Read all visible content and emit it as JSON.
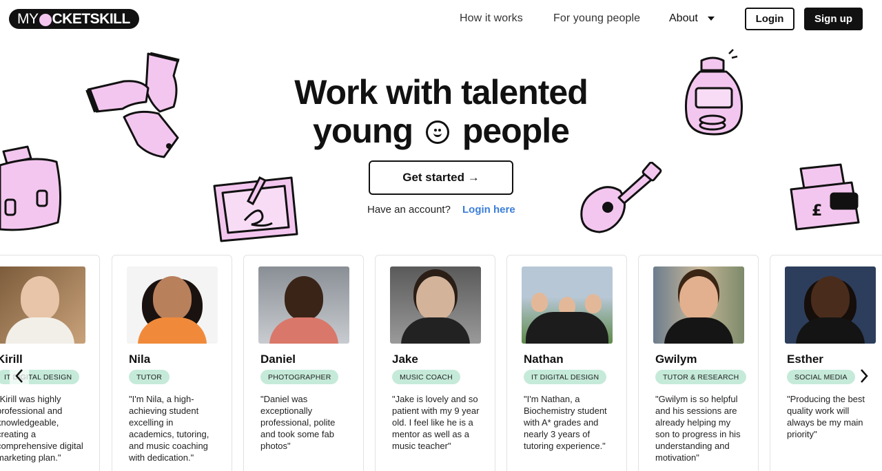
{
  "header": {
    "logo_left": "MY",
    "logo_right": "CKETSKILL",
    "nav": [
      {
        "label": "How it works"
      },
      {
        "label": "For young people"
      },
      {
        "label": "About"
      }
    ],
    "login_label": "Login",
    "signup_label": "Sign up"
  },
  "hero": {
    "title_line1": "Work with talented",
    "title_line2a": "young",
    "title_line2b": "people",
    "cta_label": "Get started →",
    "have_account": "Have an account?",
    "login_here": "Login here"
  },
  "cards": [
    {
      "name": "Kirill",
      "tag": "IT DIGITAL DESIGN",
      "quote": "\"Kirill was highly professional and knowledgeable, creating a comprehensive digital marketing plan.\""
    },
    {
      "name": "Nila",
      "tag": "TUTOR",
      "quote": "\"I'm Nila, a high-achieving student excelling in academics, tutoring, and music coaching with dedication.\""
    },
    {
      "name": "Daniel",
      "tag": "PHOTOGRAPHER",
      "quote": "\"Daniel was exceptionally professional, polite and took some fab photos\""
    },
    {
      "name": "Jake",
      "tag": "MUSIC COACH",
      "quote": "\"Jake is lovely and so patient with my 9 year old. I feel like he is a mentor as well as a music teacher\""
    },
    {
      "name": "Nathan",
      "tag": "IT DIGITAL DESIGN",
      "quote": "\"I'm Nathan, a Biochemistry student with A* grades and nearly 3 years of tutoring experience.\""
    },
    {
      "name": "Gwilym",
      "tag": "TUTOR & RESEARCH",
      "quote": "\"Gwilym is so helpful and his sessions are already helping my son to progress in his understanding and motivation\""
    },
    {
      "name": "Esther",
      "tag": "SOCIAL MEDIA",
      "quote": "\"Producing the best quality work will always be my main priority\""
    }
  ],
  "colors": {
    "accent_pink": "#f3c6ef",
    "tag_green": "#c5ead9",
    "link_blue": "#3b7dd8"
  }
}
